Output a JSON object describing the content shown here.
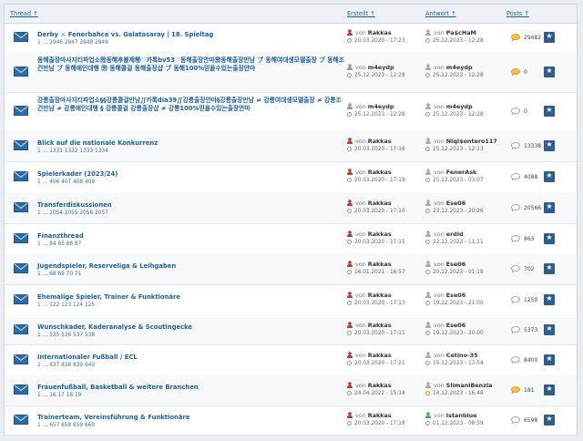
{
  "header": {
    "thread": "Thread ↑",
    "erstellt": "Erstellt ↑",
    "antwort": "Antwort ↑",
    "posts": "Posts ↑"
  },
  "colors": {
    "accent": "#1a5f9e",
    "star_bg": "#2b5c94",
    "creator": "#c0392b",
    "bubble_hot": "#f2a800"
  },
  "rows": [
    {
      "title": "Derby ⚔ Fenerbahce vs. Galatasaray | 18. Spieltag",
      "pages": [
        "1",
        "…",
        "2946",
        "2947",
        "2948",
        "2949"
      ],
      "creator": "Rakkas",
      "created": "20.03.2020 - 17:23",
      "replier": "Pa$cHaM",
      "replied": "25.12.2023 - 12:28",
      "posts": "29482",
      "bubble": "hot",
      "replier_icon": "neutral"
    },
    {
      "title": "동해출장마사지티파업소㊘동해후불제㊕♡카톡bv53♡동해출장안마㊘동해출장만남 ブ 동해여대생모델출장 ブ 동해조건만남 ブ 동해애인대행 ㊘ 동해콜걸 동해출장샵 ブ 동해100%믿을수있는출장안마",
      "pages": [],
      "creator": "m4eydp",
      "created": "25.12.2023 - 12:28",
      "replier": "m4eydp",
      "replied": "25.12.2023 - 12:28",
      "posts": "0",
      "bubble": "hot",
      "replier_icon": "neutral"
    },
    {
      "title": "강릉출장마사지티파업소§§강릉콜걸만남∬카톡dia39∬강릉출장안마§강릉출장만남 ≠ 강릉여대생모델출장 ≠ 강릉조건만남 ≠ 강릉애인대행 § 강릉콜걸 강릉출장샵 ≠ 강릉100%믿을수있는출장안마",
      "pages": [],
      "creator": "m4eydp",
      "created": "25.12.2023 - 12:28",
      "replier": "m4eydp",
      "replied": "25.12.2023 - 12:28",
      "posts": "0",
      "bubble": "plain",
      "replier_icon": "neutral"
    },
    {
      "title": "Blick auf die nationale Konkurrenz",
      "pages": [
        "1",
        "…",
        "1331",
        "1332",
        "1333",
        "1334"
      ],
      "creator": "Rakkas",
      "created": "20.03.2020 - 17:16",
      "replier": "Niqi$ontero117",
      "replied": "25.12.2023 - 12:13",
      "posts": "13338",
      "bubble": "plain",
      "replier_icon": "neutral"
    },
    {
      "title": "Spielerkader (2023/24)",
      "pages": [
        "1",
        "…",
        "406",
        "407",
        "408",
        "409"
      ],
      "creator": "Rakkas",
      "created": "20.03.2020 - 17:19",
      "replier": "FenerAsk",
      "replied": "25.12.2023 - 03:07",
      "posts": "4088",
      "bubble": "plain",
      "replier_icon": "neutral"
    },
    {
      "title": "Transferdiskussionen",
      "pages": [
        "1",
        "…",
        "2054",
        "2055",
        "2056",
        "2057"
      ],
      "creator": "Rakkas",
      "created": "20.03.2020 - 17:10",
      "replier": "Ese06",
      "replied": "23.12.2023 - 20:26",
      "posts": "20566",
      "bubble": "plain",
      "replier_icon": "neutral"
    },
    {
      "title": "Finanzthread",
      "pages": [
        "1",
        "…",
        "84",
        "85",
        "86",
        "87"
      ],
      "creator": "Rakkas",
      "created": "20.03.2020 - 17:15",
      "replier": "erdid",
      "replied": "22.12.2023 - 11:11",
      "posts": "863",
      "bubble": "plain",
      "replier_icon": "neutral"
    },
    {
      "title": "Jugendspieler, Reserveliga & Leihgaben",
      "pages": [
        "1",
        "…",
        "68",
        "69",
        "70",
        "71"
      ],
      "creator": "Rakkas",
      "created": "16.01.2021 - 16:57",
      "replier": "Ese06",
      "replied": "20.12.2023 - 01:18",
      "posts": "702",
      "bubble": "plain",
      "replier_icon": "neutral"
    },
    {
      "title": "Ehemalige Spieler, Trainer & Funktionäre",
      "pages": [
        "1",
        "…",
        "122",
        "123",
        "124",
        "125"
      ],
      "creator": "Rakkas",
      "created": "20.03.2020 - 17:13",
      "replier": "Ese06",
      "replied": "19.12.2023 - 21:00",
      "posts": "1250",
      "bubble": "plain",
      "replier_icon": "neutral"
    },
    {
      "title": "Wunschkader, Kaderanalyse & Scoutingecke",
      "pages": [
        "1",
        "…",
        "535",
        "536",
        "537",
        "538"
      ],
      "creator": "Rakkas",
      "created": "20.03.2020 - 17:11",
      "replier": "Ese06",
      "replied": "19.12.2023 - 20:00",
      "posts": "5373",
      "bubble": "plain",
      "replier_icon": "neutral"
    },
    {
      "title": "Internationaler Fußball / ECL",
      "pages": [
        "1",
        "…",
        "837",
        "838",
        "839",
        "840"
      ],
      "creator": "Rakkas",
      "created": "20.03.2020 - 17:21",
      "replier": "Cetino-35",
      "replied": "15.12.2023 - 13:54",
      "posts": "8400",
      "bubble": "plain",
      "replier_icon": "neutral"
    },
    {
      "title": "Frauenfußball, Basketball & weitere Branchen",
      "pages": [
        "1",
        "…",
        "16",
        "17",
        "18",
        "19"
      ],
      "creator": "Rakkas",
      "created": "24.04.2022 - 15:14",
      "replier": "SlimaniBenzia",
      "replied": "14.12.2023 - 16:48",
      "posts": "181",
      "bubble": "hot",
      "replier_icon": "neutral"
    },
    {
      "title": "Trainerteam, Vereinsführung & Funktionäre",
      "pages": [
        "1",
        "…",
        "657",
        "658",
        "659",
        "660"
      ],
      "creator": "Rakkas",
      "created": "20.03.2020 - 17:18",
      "replier": "Istanblue",
      "replied": "01.12.2023 - 08:59",
      "posts": "6598",
      "bubble": "plain",
      "replier_icon": "green"
    }
  ]
}
